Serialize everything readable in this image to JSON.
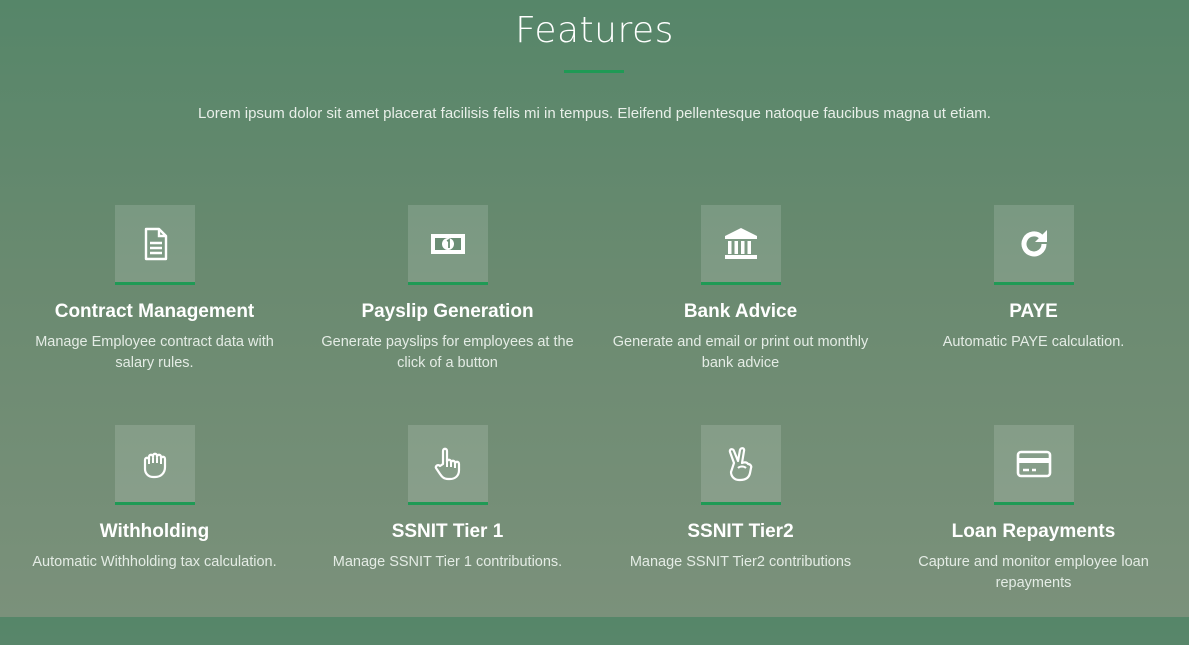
{
  "section": {
    "title": "Features",
    "intro": "Lorem ipsum dolor sit amet placerat facilisis felis mi in tempus. Eleifend pellentesque natoque faucibus magna ut etiam."
  },
  "colors": {
    "accent": "#1f9a55",
    "bg_top": "#568669",
    "bg_bottom": "#7b917b"
  },
  "features": [
    {
      "icon": "document-icon",
      "title": "Contract Management",
      "desc": "Manage Employee contract data with salary rules."
    },
    {
      "icon": "banknote-icon",
      "title": "Payslip Generation",
      "desc": "Generate payslips for employees at the click of a button"
    },
    {
      "icon": "bank-icon",
      "title": "Bank Advice",
      "desc": "Generate and email or print out monthly bank advice"
    },
    {
      "icon": "refresh-icon",
      "title": "PAYE",
      "desc": "Automatic PAYE calculation."
    },
    {
      "icon": "fist-icon",
      "title": "Withholding",
      "desc": "Automatic Withholding tax calculation."
    },
    {
      "icon": "pointing-hand-icon",
      "title": "SSNIT Tier 1",
      "desc": "Manage SSNIT Tier 1 contributions."
    },
    {
      "icon": "peace-hand-icon",
      "title": "SSNIT Tier2",
      "desc": "Manage SSNIT Tier2 contributions"
    },
    {
      "icon": "credit-card-icon",
      "title": "Loan Repayments",
      "desc": "Capture and monitor employee loan repayments"
    }
  ]
}
